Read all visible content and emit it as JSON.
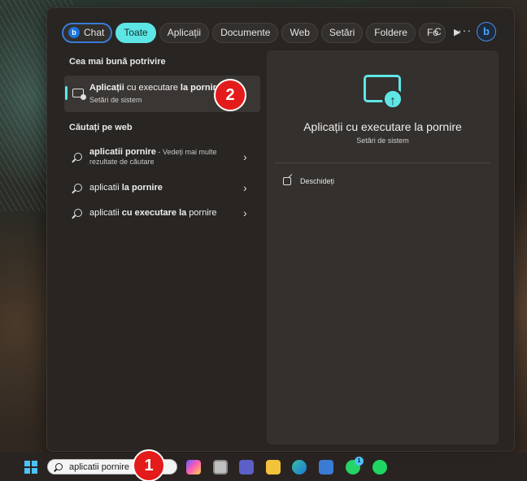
{
  "search_panel": {
    "filters": [
      {
        "label": "Chat",
        "active": false
      },
      {
        "label": "Toate",
        "active": true
      },
      {
        "label": "Aplicații",
        "active": false
      },
      {
        "label": "Documente",
        "active": false
      },
      {
        "label": "Web",
        "active": false
      },
      {
        "label": "Setări",
        "active": false
      },
      {
        "label": "Foldere",
        "active": false
      },
      {
        "label": "Fo",
        "active": false
      }
    ],
    "play_icon": "▶",
    "c_label": "C",
    "more_icon": "···",
    "bing_icon": "b",
    "best_match_heading": "Cea mai bună potrivire",
    "best_match": {
      "title_bold": "Aplicații",
      "title_mid": " cu executare ",
      "title_la": "la",
      "title_space": " ",
      "title_end": "pornire",
      "subtitle": "Setări de sistem"
    },
    "web_heading": "Căutați pe web",
    "web_results": [
      {
        "bold": "aplicatii pornire",
        "rest": " - Vedeți mai multe",
        "sub": "rezultate de căutare"
      },
      {
        "plain": "aplicatii ",
        "bold": "la pornire"
      },
      {
        "plain": "aplicatii ",
        "bold": "cu executare la",
        "plain2": " pornire"
      }
    ],
    "chevron": "›",
    "detail": {
      "icon_glyph": "↑",
      "title": "Aplicații cu executare la pornire",
      "subtitle": "Setări de sistem",
      "action_label": "Deschideți"
    }
  },
  "annotations": {
    "badge_1": "1",
    "badge_2": "2"
  },
  "taskbar": {
    "search_query": "aplicatii pornire",
    "whatsapp_badge": "1",
    "icons": [
      "windows-start",
      "search",
      "copilot",
      "task-view",
      "teams",
      "file-explorer",
      "edge",
      "store",
      "whatsapp",
      "spotify"
    ]
  },
  "colors": {
    "accent": "#5ee6e6",
    "badge_red": "#e41b1b",
    "panel_bg": "#282522"
  }
}
